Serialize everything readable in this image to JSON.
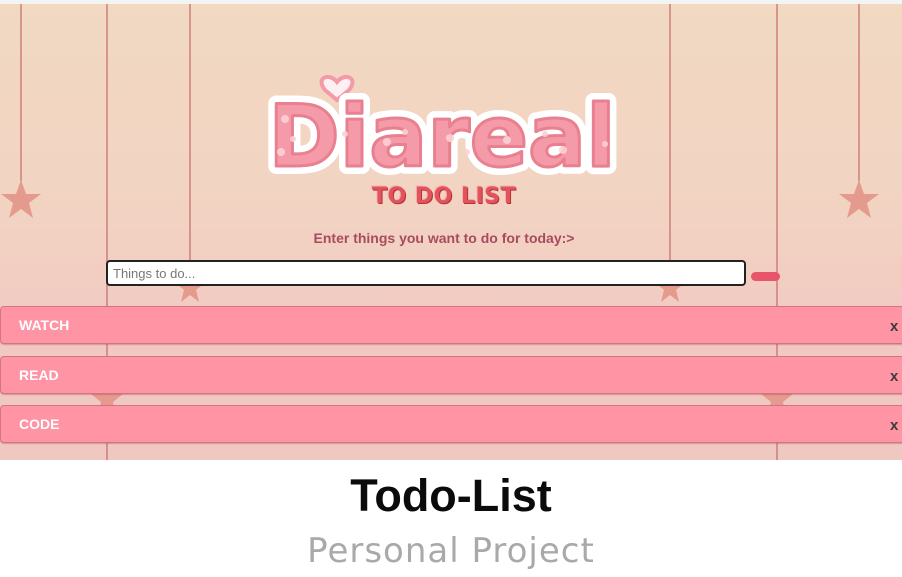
{
  "app": {
    "logo_text": "Diareal",
    "subtitle": "TO DO LIST",
    "prompt": "Enter things you want to do for today:>"
  },
  "input": {
    "placeholder": "Things to do...",
    "value": ""
  },
  "todos": [
    {
      "label": "WATCH",
      "remove_label": "x"
    },
    {
      "label": "READ",
      "remove_label": "x"
    },
    {
      "label": "CODE",
      "remove_label": "x"
    }
  ],
  "caption": {
    "title": "Todo-List",
    "subtitle": "Personal Project"
  },
  "colors": {
    "background_top": "#f1d9c2",
    "background_bottom": "#f0c8c2",
    "logo_pink": "#f59aa8",
    "accent_red": "#e0545c",
    "item_pink": "#ff94a4",
    "add_button": "#e8556a",
    "star": "#e59a8e",
    "string": "#c56a6a"
  },
  "icons": {
    "decoration": "star-icon",
    "add": "add-button"
  }
}
